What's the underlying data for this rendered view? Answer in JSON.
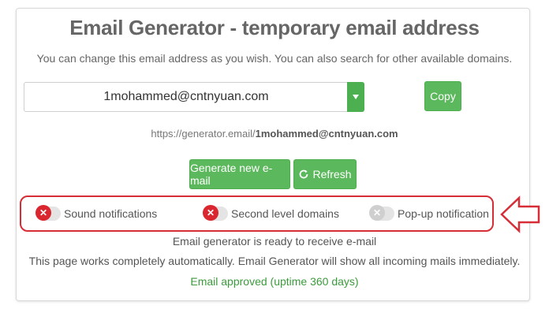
{
  "header": {
    "title": "Email Generator - temporary email address",
    "subtitle": "You can change this email address as you wish. You can also search for other available domains."
  },
  "email": {
    "value": "1mohammed@cntnyuan.com",
    "url_prefix": "https://generator.email/",
    "url_address": "1mohammed@cntnyuan.com"
  },
  "buttons": {
    "copy": "Copy",
    "generate": "Generate new e-mail",
    "refresh": "Refresh"
  },
  "toggles": [
    {
      "label": "Sound notifications",
      "state": "off"
    },
    {
      "label": "Second level domains",
      "state": "off"
    },
    {
      "label": "Pop-up notification",
      "state": "disabled"
    }
  ],
  "status": {
    "ready": "Email generator is ready to receive e-mail",
    "auto": "This page works completely automatically. Email Generator will show all incoming mails immediately.",
    "approved": "Email approved (uptime 360 days)"
  },
  "colors": {
    "accent_green": "#5cb85c",
    "toggle_off_red": "#d9262f",
    "highlight_red": "#d62d36",
    "approved_text": "#3c9a3c"
  },
  "icons": {
    "caret": "chevron-down-icon",
    "refresh": "refresh-icon",
    "toggle_off": "close-icon",
    "annotation": "left-arrow-icon"
  }
}
